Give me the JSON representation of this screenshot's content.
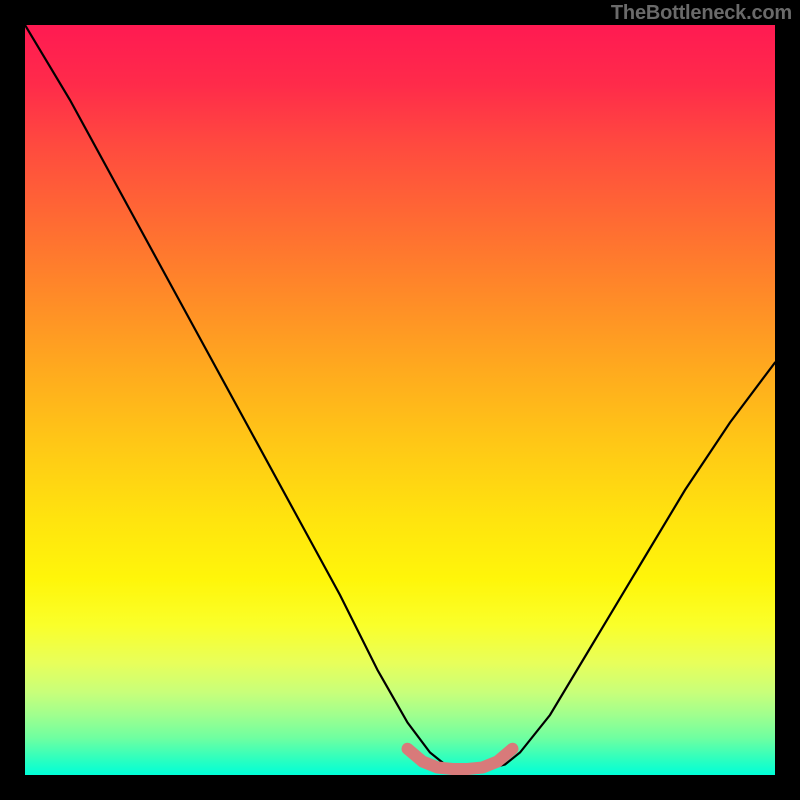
{
  "watermark": "TheBottleneck.com",
  "chart_data": {
    "type": "line",
    "title": "",
    "xlabel": "",
    "ylabel": "",
    "xlim": [
      0,
      100
    ],
    "ylim": [
      0,
      100
    ],
    "grid": false,
    "legend": false,
    "series": [
      {
        "name": "curve",
        "color": "#000000",
        "x": [
          0,
          6,
          12,
          18,
          24,
          30,
          36,
          42,
          47,
          51,
          54,
          56,
          58,
          60,
          62,
          64,
          66,
          70,
          76,
          82,
          88,
          94,
          100
        ],
        "y": [
          100,
          90,
          79,
          68,
          57,
          46,
          35,
          24,
          14,
          7,
          3,
          1.4,
          0.9,
          0.8,
          0.9,
          1.4,
          3,
          8,
          18,
          28,
          38,
          47,
          55
        ]
      },
      {
        "name": "bottom-marker",
        "color": "#d87a7a",
        "x": [
          51,
          53,
          55,
          57,
          59,
          61,
          63,
          65
        ],
        "y": [
          3.5,
          1.8,
          1.0,
          0.8,
          0.8,
          1.0,
          1.8,
          3.5
        ]
      }
    ]
  }
}
